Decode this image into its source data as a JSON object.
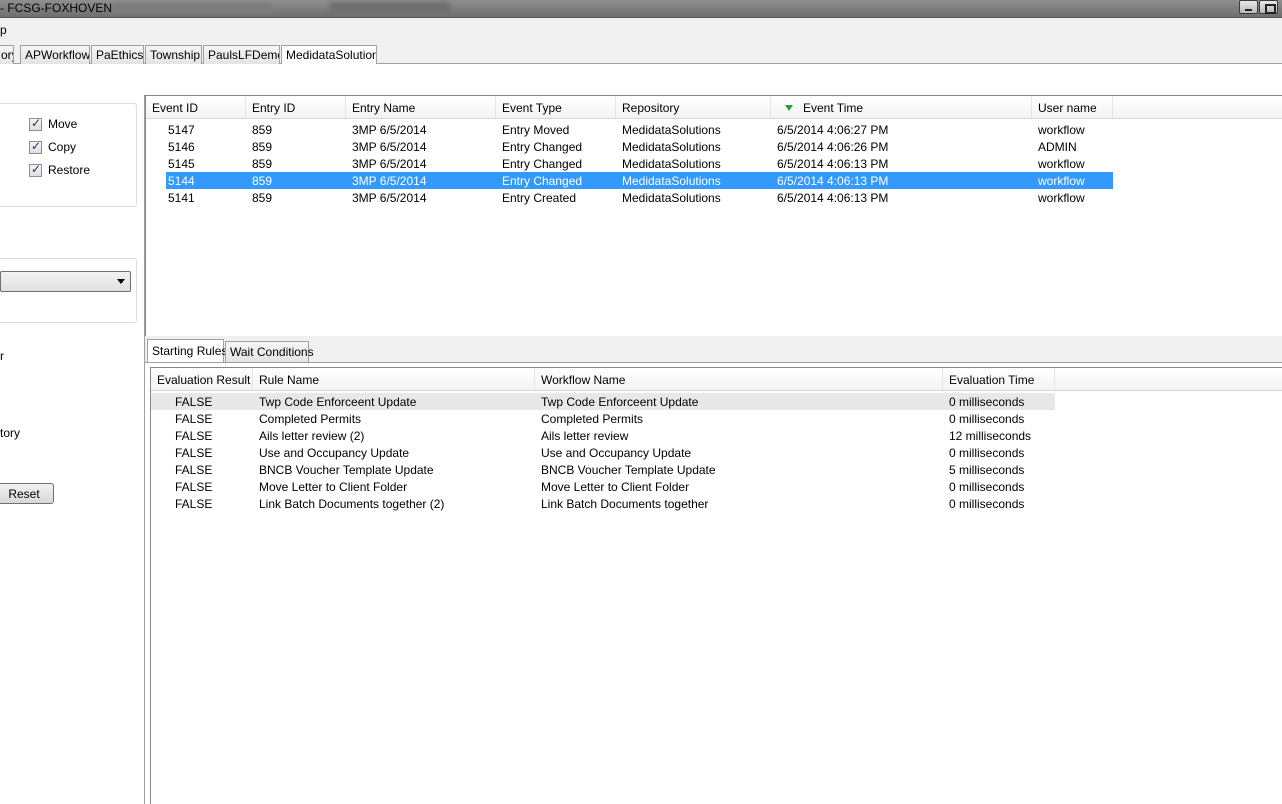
{
  "window": {
    "title": "- FCSG-FOXHOVEN"
  },
  "menubar": {
    "partial_item": "p"
  },
  "repo_tabs": [
    {
      "label": "ory"
    },
    {
      "label": "APWorkflow"
    },
    {
      "label": "PaEthics"
    },
    {
      "label": "Township"
    },
    {
      "label": "PaulsLFDemo"
    },
    {
      "label": "MedidataSolutions"
    }
  ],
  "filters": {
    "checkboxes": [
      {
        "label": "Move",
        "checked": true
      },
      {
        "label": "Copy",
        "checked": true
      },
      {
        "label": "Restore",
        "checked": true
      }
    ],
    "combo_value": "",
    "partial_label_1": "r",
    "partial_label_2": "tory",
    "reset_label": "Reset"
  },
  "events": {
    "columns": [
      "Event ID",
      "Entry ID",
      "Entry Name",
      "Event Type",
      "Repository",
      "Event Time",
      "User name"
    ],
    "sorted_column": "Event Time",
    "rows": [
      [
        "5147",
        "859",
        "3MP 6/5/2014",
        "Entry Moved",
        "MedidataSolutions",
        "6/5/2014 4:06:27 PM",
        "workflow"
      ],
      [
        "5146",
        "859",
        "3MP 6/5/2014",
        "Entry Changed",
        "MedidataSolutions",
        "6/5/2014 4:06:26 PM",
        "ADMIN"
      ],
      [
        "5145",
        "859",
        "3MP 6/5/2014",
        "Entry Changed",
        "MedidataSolutions",
        "6/5/2014 4:06:13 PM",
        "workflow"
      ],
      [
        "5144",
        "859",
        "3MP 6/5/2014",
        "Entry Changed",
        "MedidataSolutions",
        "6/5/2014 4:06:13 PM",
        "workflow"
      ],
      [
        "5141",
        "859",
        "3MP 6/5/2014",
        "Entry Created",
        "MedidataSolutions",
        "6/5/2014 4:06:13 PM",
        "workflow"
      ]
    ],
    "selected_row": 3
  },
  "detail_tabs": [
    {
      "label": "Starting Rules",
      "active": true
    },
    {
      "label": "Wait Conditions",
      "active": false
    }
  ],
  "rules": {
    "columns": [
      "Evaluation Result",
      "Rule Name",
      "Workflow Name",
      "Evaluation Time"
    ],
    "rows": [
      [
        "FALSE",
        "Twp Code Enforceent Update",
        "Twp Code Enforceent Update",
        "0 milliseconds"
      ],
      [
        "FALSE",
        "Completed Permits",
        "Completed Permits",
        "0 milliseconds"
      ],
      [
        "FALSE",
        "Ails letter review (2)",
        "Ails letter review",
        "12 milliseconds"
      ],
      [
        "FALSE",
        "Use and Occupancy Update",
        "Use and Occupancy Update",
        "0 milliseconds"
      ],
      [
        "FALSE",
        "BNCB Voucher Template Update",
        "BNCB Voucher Template Update",
        "5 milliseconds"
      ],
      [
        "FALSE",
        "Move Letter to Client Folder",
        "Move Letter to Client Folder",
        "0 milliseconds"
      ],
      [
        "FALSE",
        "Link Batch Documents together (2)",
        "Link Batch Documents together",
        "0 milliseconds"
      ]
    ],
    "hover_row": 0
  },
  "colors": {
    "selection": "#3399ff",
    "sort_arrow": "#2e9c3a"
  }
}
